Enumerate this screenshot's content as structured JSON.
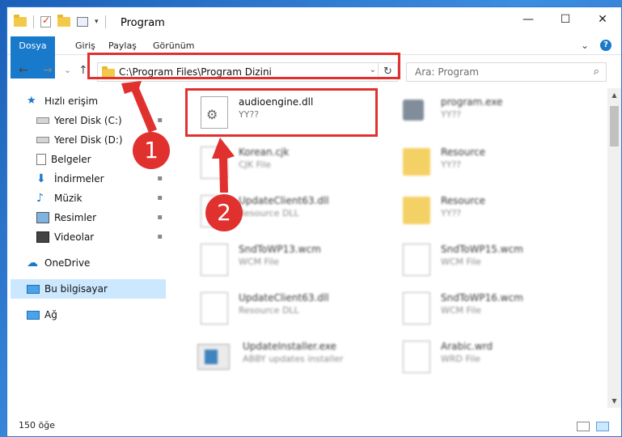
{
  "window": {
    "title": "Program",
    "controls": {
      "minimize": "—",
      "maximize": "☐",
      "close": "✕"
    }
  },
  "ribbon": {
    "tabs": [
      "Dosya",
      "Giriş",
      "Paylaş",
      "Görünüm"
    ],
    "expand": "⌄",
    "help": "?"
  },
  "nav": {
    "back": "←",
    "forward": "→",
    "recent": "⌄",
    "up": "↑",
    "address": "C:\\Program Files\\Program Dizini",
    "address_dropdown": "⌄",
    "refresh": "↻",
    "search_placeholder": "Ara: Program",
    "search_icon": "⌕"
  },
  "sidebar": {
    "items": [
      {
        "label": "Hızlı erişim",
        "icon": "star-icon",
        "pinned": false
      },
      {
        "label": "Yerel Disk (C:)",
        "icon": "drive-icon",
        "pinned": true
      },
      {
        "label": "Yerel Disk (D:)",
        "icon": "drive-icon",
        "pinned": false
      },
      {
        "label": "Belgeler",
        "icon": "documents-icon",
        "pinned": true
      },
      {
        "label": "İndirmeler",
        "icon": "download-icon",
        "pinned": true
      },
      {
        "label": "Müzik",
        "icon": "music-icon",
        "pinned": true
      },
      {
        "label": "Resimler",
        "icon": "pictures-icon",
        "pinned": true
      },
      {
        "label": "Videolar",
        "icon": "videos-icon",
        "pinned": true
      },
      {
        "label": "OneDrive",
        "icon": "cloud-icon",
        "pinned": false
      },
      {
        "label": "Bu bilgisayar",
        "icon": "computer-icon",
        "pinned": false
      },
      {
        "label": "Ağ",
        "icon": "network-icon",
        "pinned": false
      }
    ],
    "pin_glyph": "📌"
  },
  "files": [
    {
      "name": "audioengine.dll",
      "type": "YY??",
      "icon": "dll-gear-icon"
    },
    {
      "name": "program.exe",
      "type": "YY??",
      "icon": "exe-icon"
    },
    {
      "name": "Korean.cjk",
      "type": "CJK File",
      "icon": "document-icon"
    },
    {
      "name": "Resource",
      "type": "YY??",
      "icon": "folder-icon"
    },
    {
      "name": "UpdateClient63.dll",
      "type": "Resource DLL",
      "icon": "dll-gear-icon"
    },
    {
      "name": "Resource",
      "type": "YY??",
      "icon": "folder-icon"
    },
    {
      "name": "SndToWP13.wcm",
      "type": "WCM File",
      "icon": "document-icon"
    },
    {
      "name": "SndToWP15.wcm",
      "type": "WCM File",
      "icon": "document-icon"
    },
    {
      "name": "UpdateClient63.dll",
      "type": "Resource DLL",
      "icon": "dll-gear-icon"
    },
    {
      "name": "SndToWP16.wcm",
      "type": "WCM File",
      "icon": "document-icon"
    },
    {
      "name": "UpdateInstaller.exe",
      "type": "ABBY updates installer",
      "icon": "installer-icon"
    },
    {
      "name": "Arabic.wrd",
      "type": "WRD File",
      "icon": "document-icon"
    }
  ],
  "status": {
    "count": "150 öğe"
  },
  "callouts": [
    "1",
    "2"
  ],
  "colors": {
    "accent": "#1979ca",
    "highlight": "#e0312f",
    "selected": "#cce8ff"
  }
}
